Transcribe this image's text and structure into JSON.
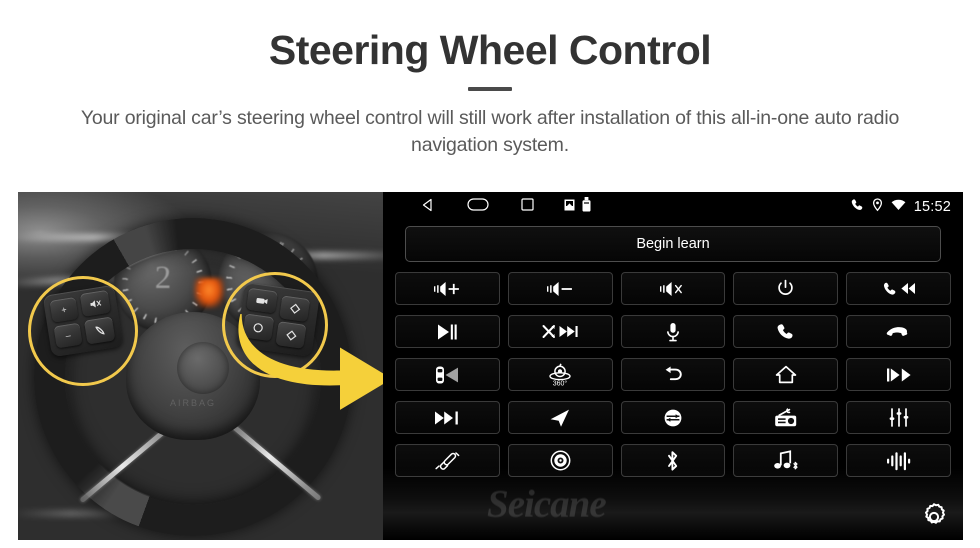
{
  "header": {
    "title": "Steering Wheel Control",
    "subtitle": "Your original car’s steering wheel control will still work after installation of this all-in-one auto radio navigation system."
  },
  "photo": {
    "alt_name": "steering-wheel-photo",
    "highlight_color": "#F2C94C",
    "arrow_color": "#F5D03A",
    "gauge_number": "2",
    "hub_logo": "AIRBAG",
    "left_cluster_buttons": [
      "volume-up",
      "volume-down",
      "mute",
      "phone"
    ],
    "right_cluster_buttons": [
      "source",
      "up",
      "mode",
      "down"
    ]
  },
  "head_unit": {
    "statusbar": {
      "nav_back": "back-icon",
      "nav_home": "home-oval-icon",
      "nav_recents": "recents-square-icon",
      "sd_icon": "sd-card-icon",
      "usb_icon": "usb-drive-icon",
      "phone_icon": "phone-icon",
      "location_icon": "location-pin-icon",
      "wifi_icon": "wifi-icon",
      "time": "15:52"
    },
    "learn_button": "Begin learn",
    "watermark": "Seicane",
    "settings_button": "gear-icon",
    "keys": [
      {
        "name": "volume-up",
        "icon": "speaker-plus"
      },
      {
        "name": "volume-down",
        "icon": "speaker-minus"
      },
      {
        "name": "mute",
        "icon": "speaker-x"
      },
      {
        "name": "power",
        "icon": "power"
      },
      {
        "name": "phone-previous",
        "icon": "phone-prev"
      },
      {
        "name": "play-pause",
        "icon": "play-pause"
      },
      {
        "name": "shuffle-next",
        "icon": "shuffle-next"
      },
      {
        "name": "microphone",
        "icon": "mic"
      },
      {
        "name": "answer-call",
        "icon": "phone"
      },
      {
        "name": "end-call",
        "icon": "phone-hangup"
      },
      {
        "name": "parking-radar",
        "icon": "car-radar"
      },
      {
        "name": "camera-360",
        "icon": "camera-360",
        "label": "360°"
      },
      {
        "name": "back",
        "icon": "back-arrow"
      },
      {
        "name": "home",
        "icon": "home"
      },
      {
        "name": "previous-track",
        "icon": "prev-track"
      },
      {
        "name": "next-track",
        "icon": "next-track"
      },
      {
        "name": "navigation",
        "icon": "nav-arrow"
      },
      {
        "name": "source-mode",
        "icon": "mode-circle"
      },
      {
        "name": "radio",
        "icon": "radio"
      },
      {
        "name": "equalizer",
        "icon": "equalizer"
      },
      {
        "name": "aux-input",
        "icon": "plug"
      },
      {
        "name": "dvd",
        "icon": "disc"
      },
      {
        "name": "bluetooth",
        "icon": "bluetooth"
      },
      {
        "name": "bluetooth-music",
        "icon": "bt-music"
      },
      {
        "name": "voice-waveform",
        "icon": "waveform"
      }
    ]
  }
}
